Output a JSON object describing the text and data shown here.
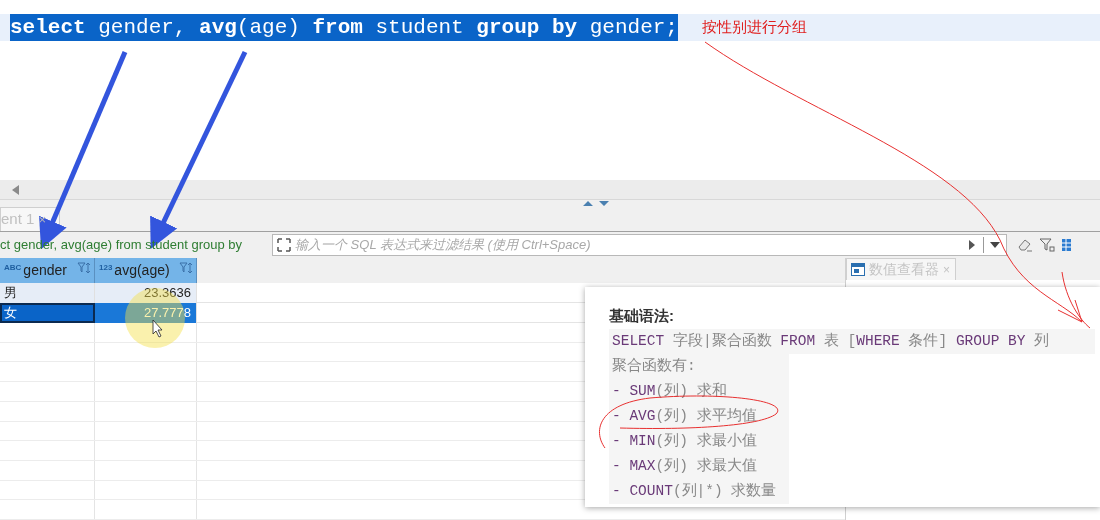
{
  "editor": {
    "selected": true,
    "sql": [
      {
        "text": "select",
        "kind": "keyword"
      },
      {
        "text": " gender, ",
        "kind": "plain"
      },
      {
        "text": "avg",
        "kind": "keyword"
      },
      {
        "text": "(age) ",
        "kind": "plain"
      },
      {
        "text": "from",
        "kind": "keyword"
      },
      {
        "text": " student ",
        "kind": "plain"
      },
      {
        "text": "group by",
        "kind": "keyword"
      },
      {
        "text": " gender;",
        "kind": "plain"
      }
    ],
    "note": "按性别进行分组"
  },
  "results": {
    "tab": {
      "label": "ent 1",
      "close": "×"
    },
    "query": "ct gender, avg(age) from student group by",
    "filter": {
      "placeholder": "输入一个 SQL 表达式来过滤结果 (使用 Ctrl+Space)"
    },
    "columns": [
      {
        "type": "ABC",
        "name": "gender"
      },
      {
        "type": "123",
        "name": "avg(age)"
      }
    ],
    "rows": [
      {
        "cells": [
          "男",
          "23.3636"
        ],
        "selected": false
      },
      {
        "cells": [
          "女",
          "27.7778"
        ],
        "selected": true
      }
    ]
  },
  "value_viewer": {
    "title": "数值查看器",
    "close": "×"
  },
  "popup": {
    "heading": "基础语法:",
    "lines": [
      [
        {
          "text": "SELECT",
          "kind": "keyword"
        },
        {
          "text": " 字段|聚合函数 ",
          "kind": "plain"
        },
        {
          "text": "FROM",
          "kind": "keyword"
        },
        {
          "text": " 表 [",
          "kind": "plain"
        },
        {
          "text": "WHERE",
          "kind": "keyword"
        },
        {
          "text": " 条件] ",
          "kind": "plain"
        },
        {
          "text": "GROUP BY",
          "kind": "keyword"
        },
        {
          "text": " 列",
          "kind": "plain"
        }
      ],
      [
        {
          "text": "聚合函数有:",
          "kind": "plain"
        }
      ],
      [
        {
          "text": "- ",
          "kind": "keyword"
        },
        {
          "text": "SUM",
          "kind": "keyword"
        },
        {
          "text": "(列) 求和",
          "kind": "plain"
        }
      ],
      [
        {
          "text": "- ",
          "kind": "keyword"
        },
        {
          "text": "AVG",
          "kind": "keyword"
        },
        {
          "text": "(列) 求平均值",
          "kind": "plain"
        }
      ],
      [
        {
          "text": "- ",
          "kind": "keyword"
        },
        {
          "text": "MIN",
          "kind": "keyword"
        },
        {
          "text": "(列) 求最小值",
          "kind": "plain"
        }
      ],
      [
        {
          "text": "- ",
          "kind": "keyword"
        },
        {
          "text": "MAX",
          "kind": "keyword"
        },
        {
          "text": "(列) 求最大值",
          "kind": "plain"
        }
      ],
      [
        {
          "text": "- ",
          "kind": "keyword"
        },
        {
          "text": "COUNT",
          "kind": "keyword"
        },
        {
          "text": "(列|*) 求数量",
          "kind": "plain"
        }
      ]
    ]
  }
}
